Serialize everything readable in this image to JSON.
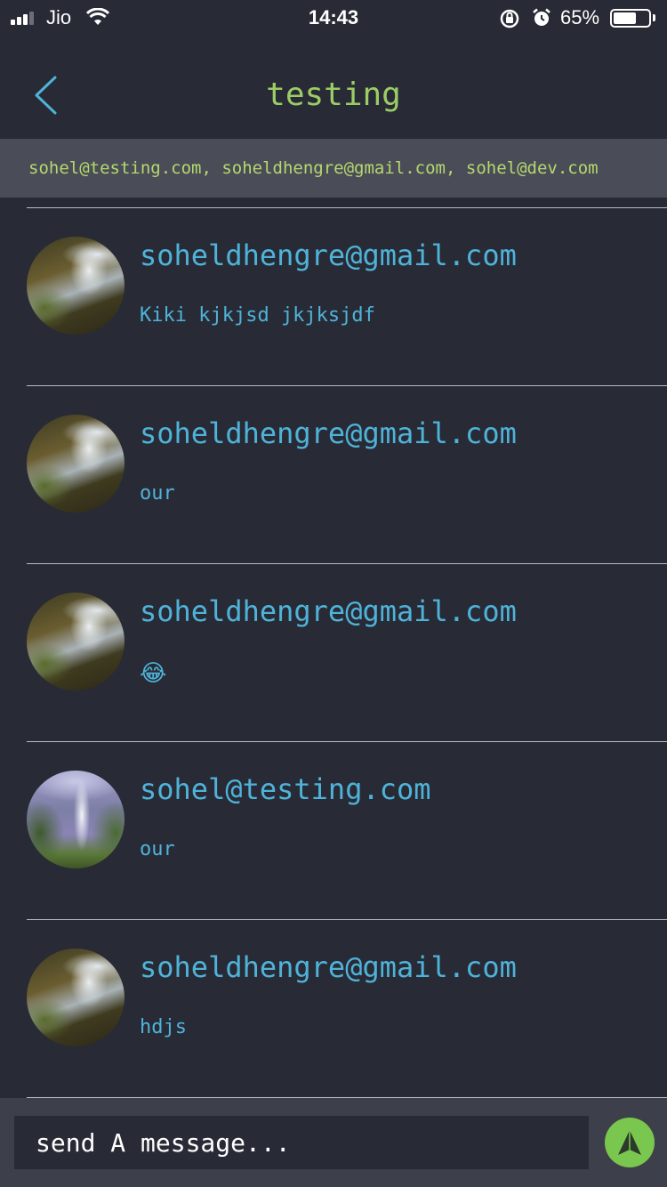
{
  "status_bar": {
    "carrier": "Jio",
    "time": "14:43",
    "battery_percent": "65%",
    "battery_level": 0.65
  },
  "header": {
    "title": "testing",
    "participants": "sohel@testing.com, soheldhengre@gmail.com, sohel@dev.com"
  },
  "messages": [
    {
      "sender": "soheldhengre@gmail.com",
      "text": "Kiki kjkjsd jkjksjdf",
      "avatar": "waterfall-photo-a"
    },
    {
      "sender": "soheldhengre@gmail.com",
      "text": "our",
      "avatar": "waterfall-photo-a"
    },
    {
      "sender": "soheldhengre@gmail.com",
      "text": "😂",
      "avatar": "waterfall-photo-a"
    },
    {
      "sender": "sohel@testing.com",
      "text": "our",
      "avatar": "waterfall-photo-b"
    },
    {
      "sender": "soheldhengre@gmail.com",
      "text": "hdjs",
      "avatar": "waterfall-photo-a"
    }
  ],
  "composer": {
    "placeholder": "send A message..."
  },
  "colors": {
    "background": "#282b36",
    "title": "#9ccc65",
    "participants_bar": "#4a4d57",
    "message_text": "#4fb3d9",
    "send_button": "#7ac74f"
  },
  "icons": {
    "back": "chevron-left-icon",
    "send": "send-arrow-icon"
  }
}
